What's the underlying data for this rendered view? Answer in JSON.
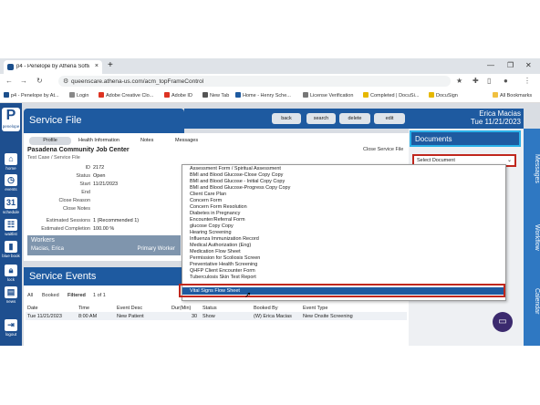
{
  "browser": {
    "tab_title": "p4 - Penelope by Athena Softw...",
    "url": "queenscare.athena-us.com/acm_topFrameControl",
    "bookmarks": [
      "p4 - Penelope by At...",
      "Login",
      "Adobe Creative Clo...",
      "Adobe ID",
      "New Tab",
      "Home - Henry Sche...",
      "License Verification",
      "Completed | DocuSi...",
      "DocuSign"
    ],
    "all_bookmarks": "All Bookmarks"
  },
  "nav": {
    "logo": "penelope",
    "items": [
      "home",
      "events",
      "schedule",
      "waitlist",
      "blue book",
      "lock",
      "news",
      "logout"
    ]
  },
  "service_file": {
    "title": "Service File",
    "toolbar": [
      "back",
      "search",
      "delete",
      "edit"
    ],
    "tabs": [
      "Profile",
      "Health Information",
      "Notes",
      "Messages"
    ],
    "case_name": "Pasadena Community Job Center",
    "case_sub": "Test Case / Service File",
    "close_link": "Close Service File",
    "fields": [
      {
        "label": "ID",
        "value": "2172"
      },
      {
        "label": "Status",
        "value": "Open"
      },
      {
        "label": "Start",
        "value": "11/21/2023"
      },
      {
        "label": "End",
        "value": ""
      },
      {
        "label": "Close Reason",
        "value": ""
      },
      {
        "label": "Close Notes",
        "value": ""
      }
    ],
    "estimated": [
      {
        "label": "Estimated Sessions",
        "value": "1 (Recommended 1)"
      },
      {
        "label": "Estimated Completion",
        "value": "100.00 %"
      }
    ],
    "workers": {
      "title": "Workers",
      "name": "Macias, Erica",
      "role": "Primary Worker"
    }
  },
  "user": {
    "name": "Erica Macias",
    "date": "Tue 11/21/2023"
  },
  "service_events": {
    "title": "Service Events",
    "filters": [
      "All",
      "Booked",
      "Filtered",
      "1 of 1"
    ],
    "columns": [
      "Date",
      "Time",
      "Event Desc",
      "Dur(Min)",
      "Status",
      "Booked By",
      "Event Type"
    ],
    "rows": [
      [
        "Tue 11/21/2023",
        "8:00 AM",
        "New Patient",
        "30",
        "Show",
        "(W) Erica Macias",
        "New Onsite Screening"
      ]
    ]
  },
  "document_options": [
    "Assessment Form / Spiritual Assessment",
    "BMI and Blood Glucose-Close Copy Copy",
    "BMI and Blood Glucose - Initial Copy Copy",
    "BMI and Blood Glucose-Progress Copy Copy",
    "Client Care Plan",
    "Concern Form",
    "Concern Form Resolution",
    "Diabetes in Pregnancy",
    "Encounter/Referral Form",
    "glucose Copy Copy",
    "Hearing Screening",
    "Influenza Immunization Record",
    "Medical Authorization (Eng)",
    "Medication Flow Sheet",
    "Permission for Scoliosis Screen",
    "Preventative Health Screening",
    "QHFP Client Encounter Form",
    "Tuberculosis Skin Test Report"
  ],
  "selected_option": "Vital Signs Flow Sheet",
  "documents": {
    "title": "Documents",
    "select_placeholder": "Select Document"
  },
  "right_tabs": [
    "Messages",
    "Workflow",
    "Calendar"
  ]
}
